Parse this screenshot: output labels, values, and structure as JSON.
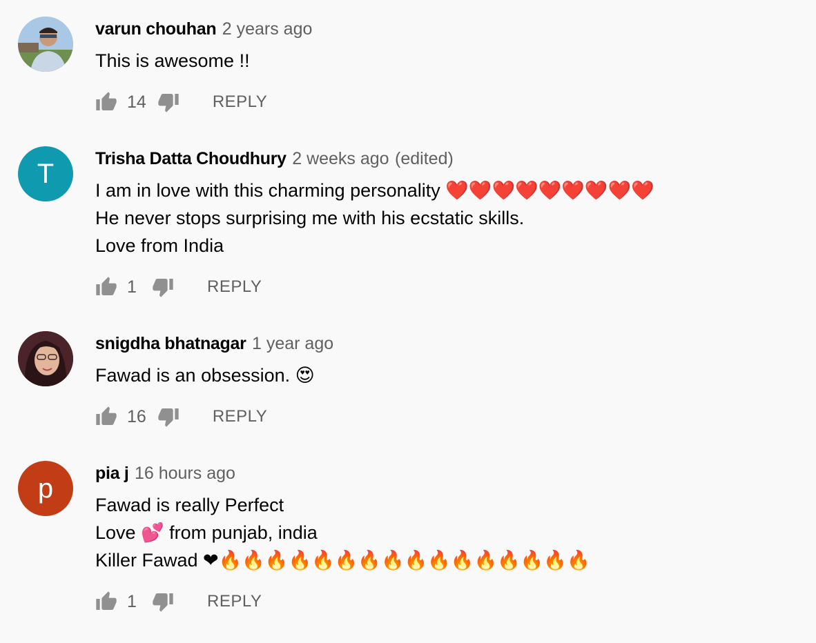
{
  "comments": [
    {
      "author": "varun chouhan",
      "time": "2 years ago",
      "edited": "",
      "avatar_letter": "",
      "avatar_color": "#8fb4d8",
      "lines": [
        "This is awesome !!"
      ],
      "likes": "14",
      "reply_label": "REPLY"
    },
    {
      "author": "Trisha Datta Choudhury",
      "time": "2 weeks ago",
      "edited": "(edited)",
      "avatar_letter": "T",
      "avatar_color": "#0f9aaf",
      "lines": [
        "I am in love with this charming personality ❤️❤️❤️❤️❤️❤️❤️❤️❤️",
        "He never stops surprising me with his ecstatic skills.",
        "Love from India"
      ],
      "likes": "1",
      "reply_label": "REPLY"
    },
    {
      "author": "snigdha bhatnagar",
      "time": "1 year ago",
      "edited": "",
      "avatar_letter": "",
      "avatar_color": "#5a2b2f",
      "lines": [
        "Fawad is an obsession. 😍"
      ],
      "likes": "16",
      "reply_label": "REPLY"
    },
    {
      "author": "pia j",
      "time": "16 hours ago",
      "edited": "",
      "avatar_letter": "p",
      "avatar_color": "#c23c15",
      "lines": [
        "Fawad is really Perfect",
        "Love 💕 from punjab, india",
        "Killer Fawad ❤🔥🔥🔥🔥🔥🔥🔥🔥🔥🔥🔥🔥🔥🔥🔥🔥"
      ],
      "likes": "1",
      "reply_label": "REPLY"
    }
  ],
  "icons": {
    "like": "thumb-up-icon",
    "dislike": "thumb-down-icon"
  },
  "colors": {
    "background": "#f9f9f9",
    "secondary_text": "#606060",
    "icon": "#909090"
  }
}
